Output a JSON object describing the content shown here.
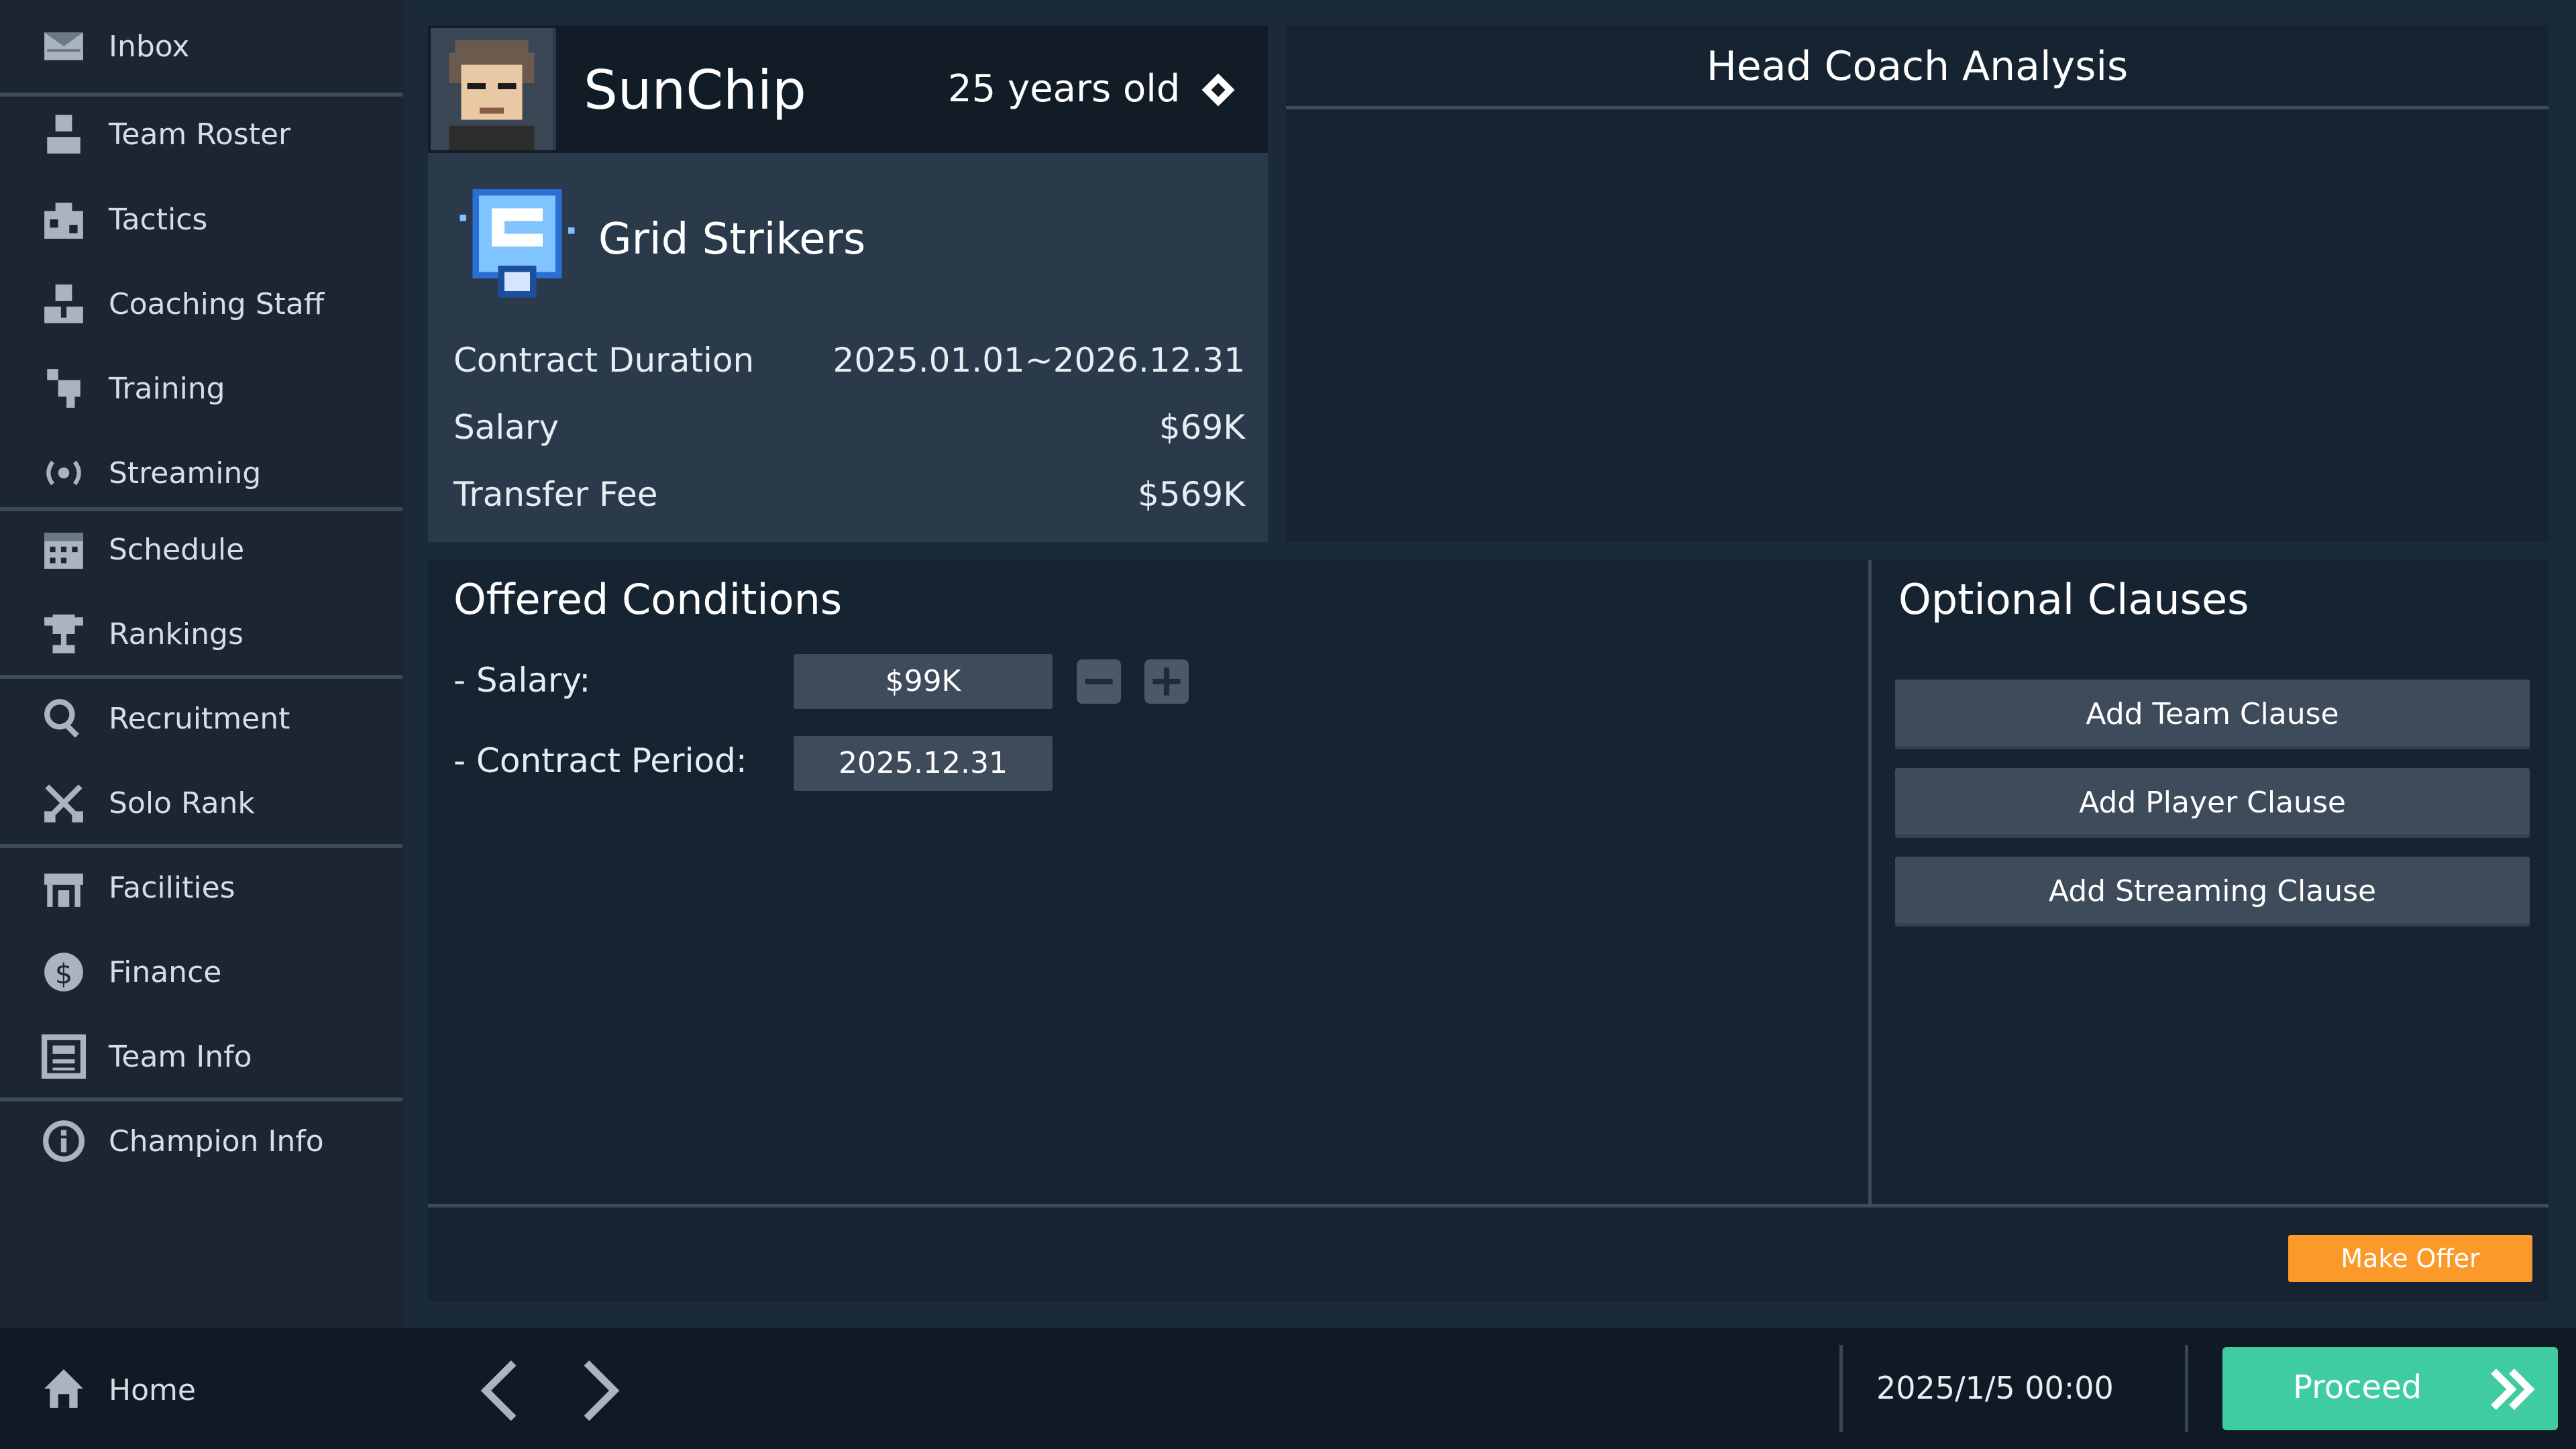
{
  "sidebar": {
    "items": [
      {
        "label": "Inbox",
        "icon": "inbox-icon"
      },
      {
        "label": "Team Roster",
        "icon": "team-roster-icon"
      },
      {
        "label": "Tactics",
        "icon": "tactics-icon"
      },
      {
        "label": "Coaching Staff",
        "icon": "coaching-staff-icon"
      },
      {
        "label": "Training",
        "icon": "training-icon"
      },
      {
        "label": "Streaming",
        "icon": "streaming-icon"
      },
      {
        "label": "Schedule",
        "icon": "schedule-icon"
      },
      {
        "label": "Rankings",
        "icon": "trophy-icon"
      },
      {
        "label": "Recruitment",
        "icon": "search-icon"
      },
      {
        "label": "Solo Rank",
        "icon": "crossed-swords-icon"
      },
      {
        "label": "Facilities",
        "icon": "facilities-icon"
      },
      {
        "label": "Finance",
        "icon": "finance-icon"
      },
      {
        "label": "Team Info",
        "icon": "team-info-icon"
      },
      {
        "label": "Champion Info",
        "icon": "info-icon"
      }
    ]
  },
  "bottom_bar": {
    "home_label": "Home",
    "datetime": "2025/1/5 00:00",
    "proceed_label": "Proceed"
  },
  "player": {
    "name": "SunChip",
    "age": "25 years old",
    "team": "Grid Strikers",
    "contract_duration_label": "Contract Duration",
    "contract_duration": "2025.01.01~2026.12.31",
    "salary_label": "Salary",
    "salary": "$69K",
    "transfer_fee_label": "Transfer Fee",
    "transfer_fee": "$569K"
  },
  "coach_panel": {
    "title": "Head Coach Analysis"
  },
  "offer": {
    "title": "Offered Conditions",
    "salary_label": "- Salary:",
    "salary_value": "$99K",
    "period_label": "- Contract Period:",
    "period_value": "2025.12.31",
    "make_offer_label": "Make Offer"
  },
  "optional_clauses": {
    "title": "Optional Clauses",
    "buttons": [
      "Add Team Clause",
      "Add Player Clause",
      "Add Streaming Clause"
    ]
  },
  "colors": {
    "background": "#1b2a38",
    "sidebar": "#1b2632",
    "panel": "#162330",
    "proceed": "#3fcca0",
    "make_offer": "#fb9a2a"
  }
}
